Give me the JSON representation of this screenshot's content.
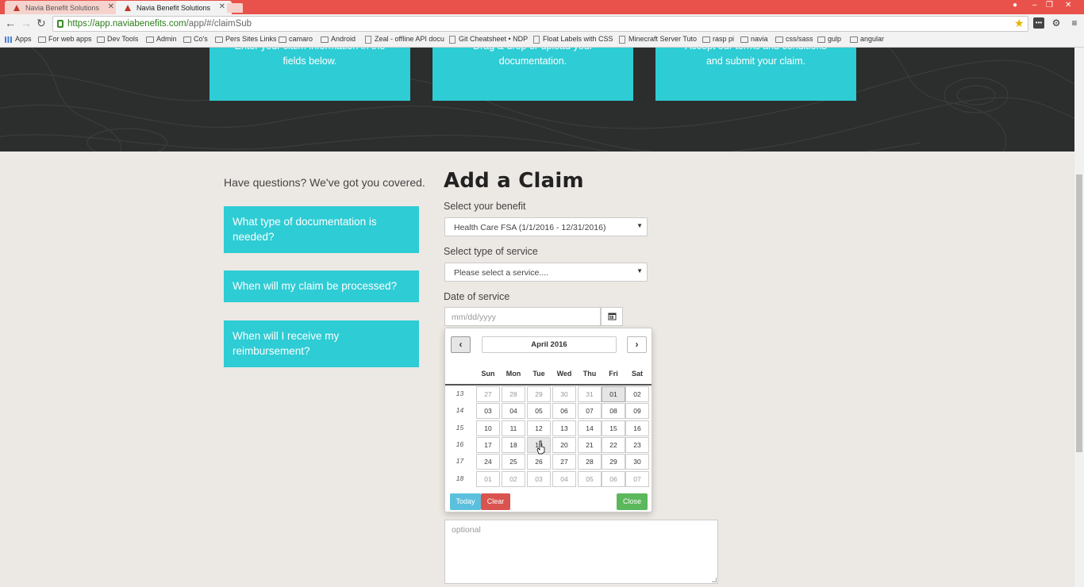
{
  "browser": {
    "tabs": [
      {
        "title": "Navia Benefit Solutions",
        "active": false
      },
      {
        "title": "Navia Benefit Solutions",
        "active": true
      }
    ],
    "url_host": "https://app.naviabenefits.com",
    "url_path": "/app/#/claimSub",
    "bookmarks": [
      {
        "label": "Apps",
        "icon": "apps-grid-icon"
      },
      {
        "label": "For web apps",
        "icon": "folder-icon"
      },
      {
        "label": "Dev Tools",
        "icon": "folder-icon"
      },
      {
        "label": "Admin",
        "icon": "folder-icon"
      },
      {
        "label": "Co's",
        "icon": "folder-icon"
      },
      {
        "label": "Pers Sites Links",
        "icon": "folder-icon"
      },
      {
        "label": "camaro",
        "icon": "folder-icon"
      },
      {
        "label": "Android",
        "icon": "folder-icon"
      },
      {
        "label": "Zeal - offline API docu",
        "icon": "page-icon"
      },
      {
        "label": "Git Cheatsheet • NDP",
        "icon": "page-icon"
      },
      {
        "label": "Float Labels with CSS",
        "icon": "page-icon"
      },
      {
        "label": "Minecraft Server Tuto",
        "icon": "page-icon"
      },
      {
        "label": "rasp pi",
        "icon": "folder-icon"
      },
      {
        "label": "navia",
        "icon": "folder-icon"
      },
      {
        "label": "css/sass",
        "icon": "folder-icon"
      },
      {
        "label": "gulp",
        "icon": "folder-icon"
      },
      {
        "label": "angular",
        "icon": "folder-icon"
      }
    ]
  },
  "hero": {
    "cards": [
      {
        "line1": "Enter your claim information in the",
        "line2": "fields below."
      },
      {
        "line1": "Drag & drop or upload your",
        "line2": "documentation."
      },
      {
        "line1": "Accept our terms and conditions",
        "line2": "and submit your claim."
      }
    ]
  },
  "sidebar": {
    "title": "Have questions? We've got you covered.",
    "faqs": [
      "What type of documentation is needed?",
      "When will my claim be processed?",
      "When will I receive my reimbursement?"
    ]
  },
  "form": {
    "heading": "Add a Claim",
    "benefit_label": "Select your benefit",
    "benefit_value": "Health Care FSA (1/1/2016 - 12/31/2016)",
    "service_label": "Select type of service",
    "service_value": "Please select a service....",
    "date_label": "Date of service",
    "date_placeholder": "mm/dd/yyyy",
    "notes_placeholder": "optional"
  },
  "calendar": {
    "month": "April 2016",
    "weekdays": [
      "Sun",
      "Mon",
      "Tue",
      "Wed",
      "Thu",
      "Fri",
      "Sat"
    ],
    "weeks": [
      {
        "num": "13",
        "days": [
          "27",
          "28",
          "29",
          "30",
          "31",
          "01",
          "02"
        ]
      },
      {
        "num": "14",
        "days": [
          "03",
          "04",
          "05",
          "06",
          "07",
          "08",
          "09"
        ]
      },
      {
        "num": "15",
        "days": [
          "10",
          "11",
          "12",
          "13",
          "14",
          "15",
          "16"
        ]
      },
      {
        "num": "16",
        "days": [
          "17",
          "18",
          "19",
          "20",
          "21",
          "22",
          "23"
        ]
      },
      {
        "num": "17",
        "days": [
          "24",
          "25",
          "26",
          "27",
          "28",
          "29",
          "30"
        ]
      },
      {
        "num": "18",
        "days": [
          "01",
          "02",
          "03",
          "04",
          "05",
          "06",
          "07"
        ]
      }
    ],
    "muted_cells": [
      [
        0,
        0
      ],
      [
        0,
        1
      ],
      [
        0,
        2
      ],
      [
        0,
        3
      ],
      [
        0,
        4
      ],
      [
        5,
        0
      ],
      [
        5,
        1
      ],
      [
        5,
        2
      ],
      [
        5,
        3
      ],
      [
        5,
        4
      ],
      [
        5,
        5
      ],
      [
        5,
        6
      ]
    ],
    "selected_cell": [
      0,
      5
    ],
    "hover_cell": [
      3,
      2
    ],
    "buttons": {
      "today": "Today",
      "clear": "Clear",
      "close": "Close"
    },
    "colors": {
      "today": "#5bc0de",
      "clear": "#d9534f",
      "close": "#5cb85c"
    }
  },
  "colors": {
    "accent": "#2eccd4",
    "hero_bg": "#2c2d2d",
    "page_bg": "#ece8e3",
    "tabbar": "#e8524a"
  }
}
